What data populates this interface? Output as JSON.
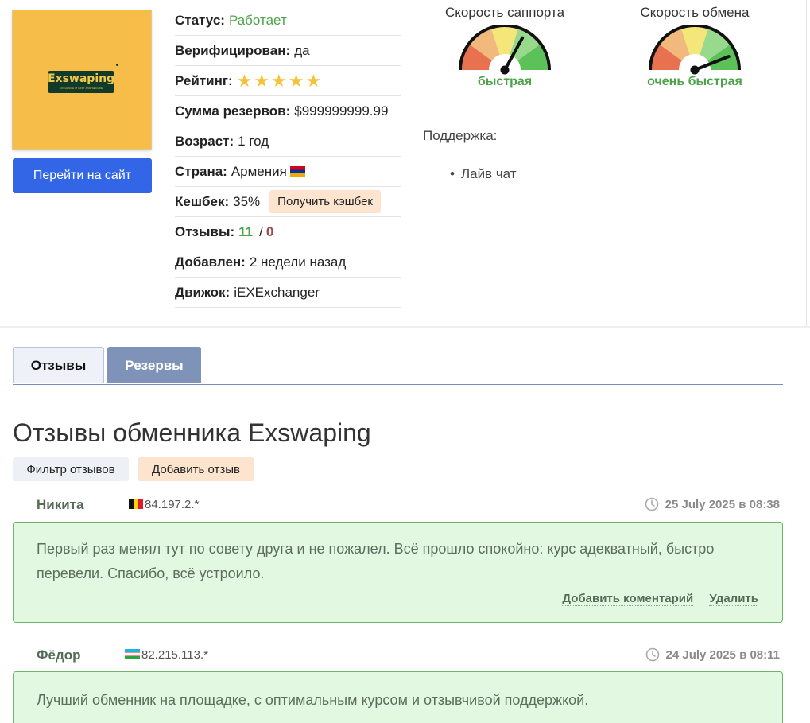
{
  "exchanger": {
    "logo_text": "Exswaping",
    "logo_subtext": "EXCHANGE IT FAST AND SECURE",
    "visit_button": "Перейти на сайт"
  },
  "info": {
    "status_label": "Статус:",
    "status_value": "Работает",
    "verified_label": "Верифицирован:",
    "verified_value": "да",
    "rating_label": "Рейтинг:",
    "rating_stars": "★★★★★",
    "rating_value": 5,
    "reserves_label": "Сумма резервов:",
    "reserves_value": "$999999999.99",
    "age_label": "Возраст:",
    "age_value": "1 год",
    "country_label": "Страна:",
    "country_value": "Армения",
    "cashback_label": "Кешбек:",
    "cashback_value": "35%",
    "cashback_button": "Получить кэшбек",
    "reviews_label": "Отзывы:",
    "reviews_positive": "11",
    "reviews_separator": "/",
    "reviews_negative": "0",
    "added_label": "Добавлен:",
    "added_value": "2 недели назад",
    "engine_label": "Движок:",
    "engine_value": "iEXExchanger"
  },
  "gauges": [
    {
      "title": "Скорость саппорта",
      "label": "быстрая",
      "level": 0.66
    },
    {
      "title": "Скорость обмена",
      "label": "очень быстрая",
      "level": 0.88
    }
  ],
  "support": {
    "title": "Поддержка:",
    "items": [
      "Лайв чат"
    ]
  },
  "tabs": [
    {
      "label": "Отзывы",
      "active": true
    },
    {
      "label": "Резервы",
      "active": false
    }
  ],
  "reviews_section": {
    "heading": "Отзывы обменника Exswaping",
    "filter_button": "Фильтр отзывов",
    "add_button": "Добавить отзыв",
    "comment_action": "Добавить коментарий",
    "delete_action": "Удалить"
  },
  "reviews": [
    {
      "name": "Никита",
      "ip": "84.197.2.*",
      "country_flag": "belgium",
      "date": "25 July 2025 в 08:38",
      "text": "Первый раз менял тут по совету друга и не пожалел. Всё прошло спокойно: курс адекватный, быстро перевели. Спасибо, всё устроило."
    },
    {
      "name": "Фёдор",
      "ip": "82.215.113.*",
      "country_flag": "uzbekistan",
      "date": "24 July 2025 в 08:11",
      "text": "Лучший обменник на площадке, с оптимальным курсом и отзывчивой поддержкой."
    }
  ],
  "colors": {
    "accent_blue": "#3366e6",
    "status_green": "#4ca34a",
    "review_bg": "#e2f8e0",
    "review_border": "#6db36a",
    "cashback_bg": "#fde4cf",
    "tab_inactive": "#7f92b8"
  }
}
